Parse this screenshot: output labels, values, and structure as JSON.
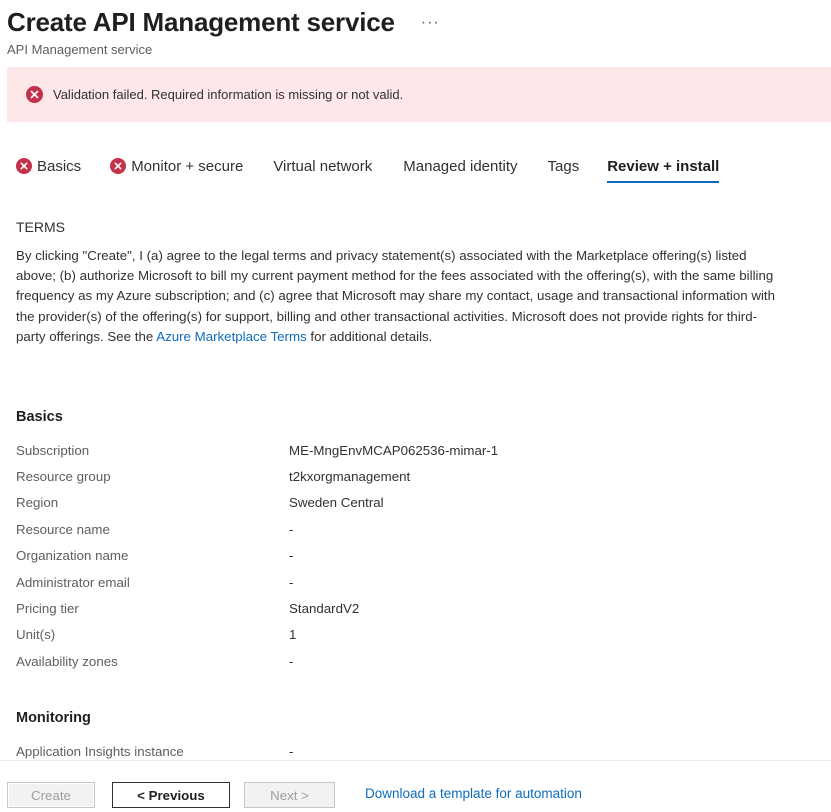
{
  "header": {
    "title": "Create API Management service",
    "more": "···",
    "subtitle": "API Management service"
  },
  "validation": {
    "message": "Validation failed. Required information is missing or not valid.",
    "color": "#c4314b"
  },
  "tabs": [
    {
      "label": "Basics",
      "error": true
    },
    {
      "label": "Monitor + secure",
      "error": true
    },
    {
      "label": "Virtual network",
      "error": false
    },
    {
      "label": "Managed identity",
      "error": false
    },
    {
      "label": "Tags",
      "error": false
    },
    {
      "label": "Review + install",
      "error": false,
      "active": true
    }
  ],
  "terms": {
    "heading": "TERMS",
    "body_before_link": "By clicking \"Create\", I (a) agree to the legal terms and privacy statement(s) associated with the Marketplace offering(s) listed above; (b) authorize Microsoft to bill my current payment method for the fees associated with the offering(s), with the same billing frequency as my Azure subscription; and (c) agree that Microsoft may share my contact, usage and transactional information with the provider(s) of the offering(s) for support, billing and other transactional activities. Microsoft does not provide rights for third-party offerings. See the ",
    "link_text": "Azure Marketplace Terms",
    "body_after_link": " for additional details."
  },
  "basics": {
    "heading": "Basics",
    "rows": [
      {
        "key": "Subscription",
        "value": "ME-MngEnvMCAP062536-mimar-1"
      },
      {
        "key": "Resource group",
        "value": "t2kxorgmanagement"
      },
      {
        "key": "Region",
        "value": "Sweden Central"
      },
      {
        "key": "Resource name",
        "value": "-"
      },
      {
        "key": "Organization name",
        "value": "-"
      },
      {
        "key": "Administrator email",
        "value": "-"
      },
      {
        "key": "Pricing tier",
        "value": "StandardV2"
      },
      {
        "key": "Unit(s)",
        "value": "1"
      },
      {
        "key": "Availability zones",
        "value": "-"
      }
    ]
  },
  "monitoring": {
    "heading": "Monitoring",
    "rows": [
      {
        "key": "Application Insights instance",
        "value": "-"
      }
    ]
  },
  "footer": {
    "create_label": "Create",
    "previous_label": "< Previous",
    "next_label": "Next >",
    "template_link": "Download a template for automation"
  },
  "colors": {
    "accent": "#0f6cbd",
    "error": "#c4314b",
    "banner_bg": "#fde7e9"
  }
}
